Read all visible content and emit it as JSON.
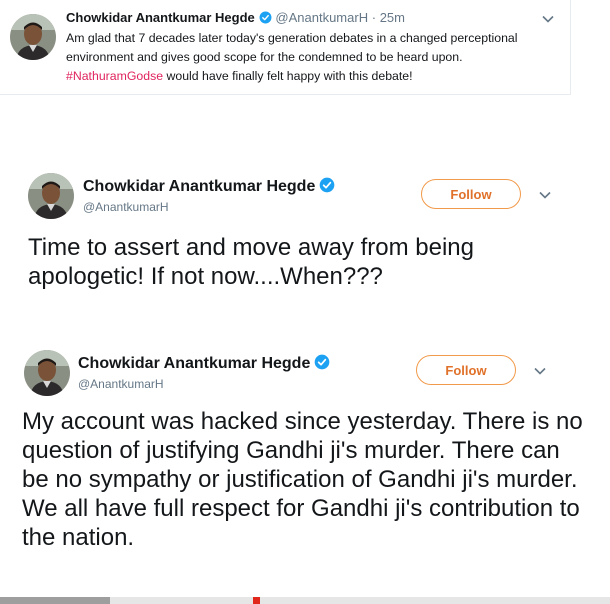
{
  "tweets": [
    {
      "name": "Chowkidar Anantkumar Hegde",
      "handle": "@AnantkumarH",
      "separator": "·",
      "time": "25m",
      "text_before": "Am glad that 7 decades later today's generation debates in a changed perceptional environment and gives good scope for the  condemned to be heard upon. ",
      "hashtag": "#NathuramGodse",
      "text_after": " would have finally felt happy with this debate!"
    },
    {
      "name": "Chowkidar Anantkumar Hegde",
      "handle": "@AnantkumarH",
      "follow_label": "Follow",
      "text": "Time to assert and move away from being apologetic!  If not now....When???"
    },
    {
      "name": "Chowkidar Anantkumar Hegde",
      "handle": "@AnantkumarH",
      "follow_label": "Follow",
      "text": "My account was hacked since yesterday. There is no question of justifying Gandhi ji's murder. There can be no sympathy or justification of Gandhi ji's murder. We all have full respect for Gandhi ji's contribution to the nation."
    }
  ],
  "icons": {
    "verified": "verified-badge-icon",
    "chevron": "chevron-down-icon",
    "avatar": "profile-photo"
  },
  "colors": {
    "verified_blue": "#1da1f2",
    "hashtag": "#e0245e",
    "follow_border": "#f29a4b",
    "follow_text": "#e0712a",
    "secondary_text": "#657786"
  }
}
